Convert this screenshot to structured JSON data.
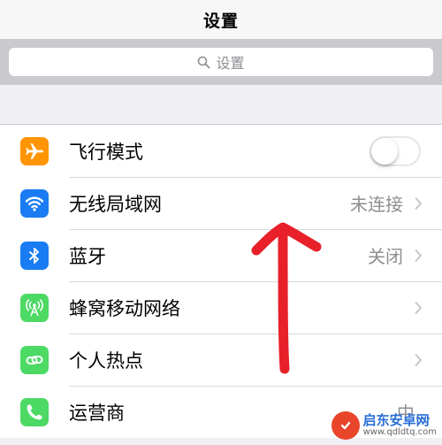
{
  "nav": {
    "title": "设置"
  },
  "search": {
    "placeholder": "设置",
    "icon": "search-icon"
  },
  "rows": [
    {
      "label": "飞行模式",
      "icon": "airplane-icon",
      "icon_color": "#ff9500",
      "toggle": "off"
    },
    {
      "label": "无线局域网",
      "icon": "wifi-icon",
      "icon_color": "#1a7cf2",
      "detail": "未连接"
    },
    {
      "label": "蓝牙",
      "icon": "bluetooth-icon",
      "icon_color": "#1a7cf2",
      "detail": "关闭"
    },
    {
      "label": "蜂窝移动网络",
      "icon": "cellular-icon",
      "icon_color": "#4cd964"
    },
    {
      "label": "个人热点",
      "icon": "hotspot-icon",
      "icon_color": "#4cd964"
    },
    {
      "label": "运营商",
      "icon": "phone-icon",
      "icon_color": "#4cd964",
      "detail": "中..."
    }
  ],
  "watermark": {
    "name": "启东安卓网",
    "url": "www.qdldtq.com"
  },
  "colors": {
    "arrow": "#e8202a",
    "chevron": "#c7c7cc"
  }
}
